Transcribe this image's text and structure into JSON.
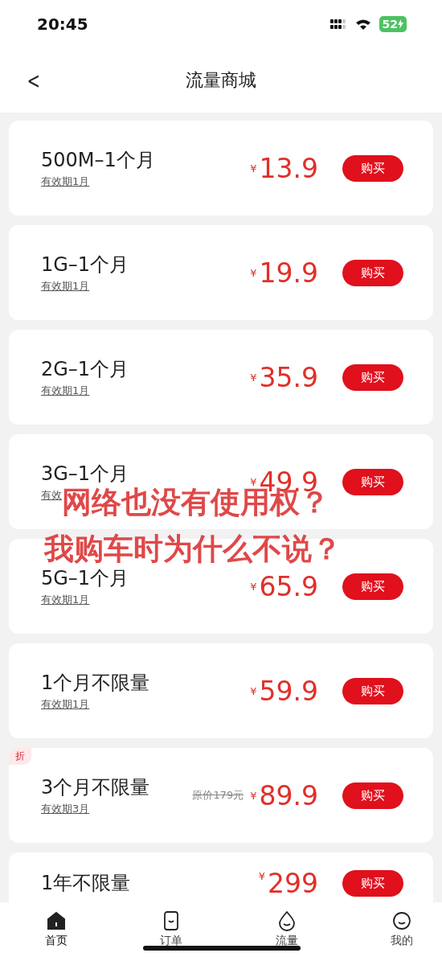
{
  "status_bar": {
    "time": "20:45",
    "battery": "52"
  },
  "nav": {
    "back": "<",
    "title": "流量商城"
  },
  "products": [
    {
      "title": "500M–1个月",
      "validity": "有效期1月",
      "currency": "¥",
      "price": "13.9",
      "button": "购买"
    },
    {
      "title": "1G–1个月",
      "validity": "有效期1月",
      "currency": "¥",
      "price": "19.9",
      "button": "购买"
    },
    {
      "title": "2G–1个月",
      "validity": "有效期1月",
      "currency": "¥",
      "price": "35.9",
      "button": "购买"
    },
    {
      "title": "3G–1个月",
      "validity": "有效",
      "currency": "¥",
      "price": "49.9",
      "button": "购买"
    },
    {
      "title": "5G–1个月",
      "validity": "有效期1月",
      "currency": "¥",
      "price": "65.9",
      "button": "购买"
    },
    {
      "title": "1个月不限量",
      "validity": "有效期1月",
      "currency": "¥",
      "price": "59.9",
      "button": "购买"
    },
    {
      "title": "3个月不限量",
      "validity": "有效期3月",
      "badge": "折",
      "original_price": "原价179元",
      "currency": "¥",
      "price": "89.9",
      "button": "购买"
    },
    {
      "title": "1年不限量",
      "currency": "¥",
      "price": "299",
      "button": "购买"
    }
  ],
  "overlay_caption": [
    "网络也没有使用权？",
    "我购车时为什么不说？"
  ],
  "tab_bar": [
    {
      "label": "首页",
      "selected": true
    },
    {
      "label": "订单",
      "selected": false
    },
    {
      "label": "流量",
      "selected": false
    },
    {
      "label": "我的",
      "selected": false
    }
  ]
}
